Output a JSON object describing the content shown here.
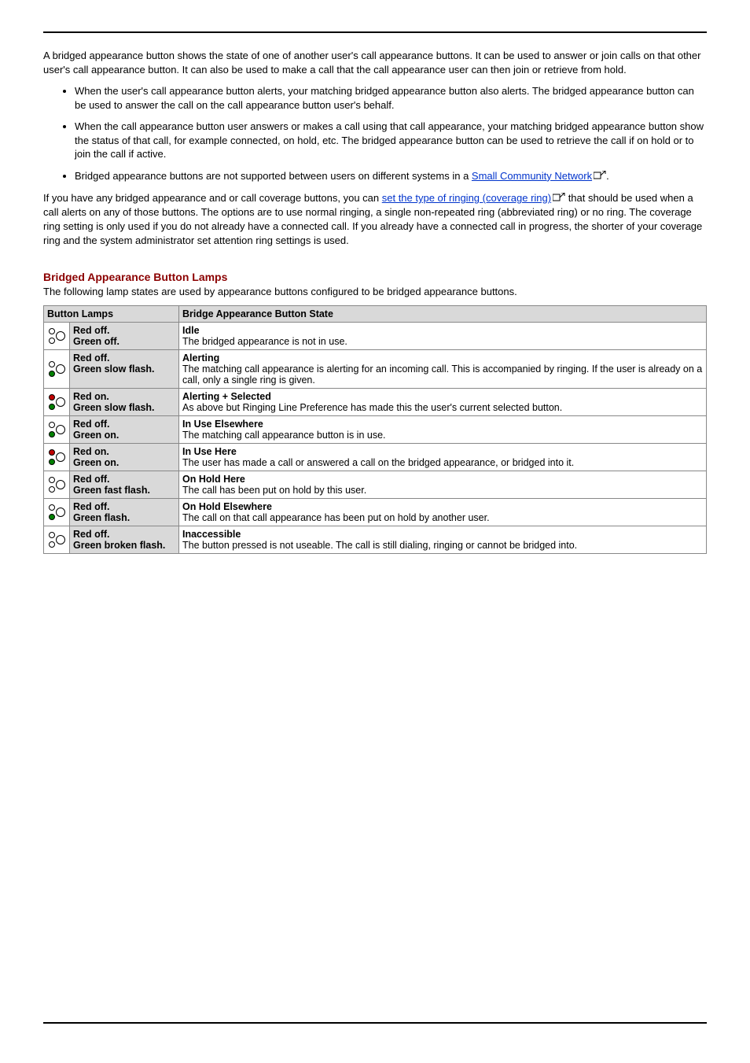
{
  "intro": "A bridged appearance button shows the state of one of another user's call appearance buttons. It can be used to answer or join calls on that other user's call appearance button. It can also be used to make a call that the call appearance user can then join or retrieve from hold.",
  "bullets": [
    "When the user's call appearance button alerts, your matching bridged appearance button also alerts. The bridged appearance button can be used to answer the call on the call appearance button user's behalf.",
    "When the call appearance button user answers or makes a call using that call appearance, your matching bridged appearance button show the status of that call, for example connected, on hold, etc. The bridged appearance button can be used to retrieve the call if on hold or to join the call if active."
  ],
  "bullet3_prefix": "Bridged appearance buttons are not supported between users on different systems in a ",
  "bullet3_link": "Small Community Network",
  "bullet3_suffix": ".",
  "para2_prefix": "If you have any bridged appearance and or call coverage buttons, you can ",
  "para2_link": "set the type of ringing (coverage ring)",
  "para2_suffix": " that should be used when a call alerts on any of those buttons. The options are to use normal ringing, a single non-repeated ring (abbreviated ring) or no ring. The coverage ring setting is only used if you do not already have a connected call. If you already have a connected call in progress, the shorter of your coverage ring and the system administrator set attention ring settings is used.",
  "section_heading": "Bridged Appearance Button Lamps",
  "section_sub": "The following lamp states are used by appearance buttons configured to be bridged appearance buttons.",
  "table": {
    "header": {
      "col1": "Button Lamps",
      "col2": "Bridge Appearance Button State"
    },
    "rows": [
      {
        "lamp": {
          "red": "off",
          "green": "off"
        },
        "label": "Red off.\nGreen off.",
        "state_title": "Idle",
        "state_desc": "The bridged appearance is not in use."
      },
      {
        "lamp": {
          "red": "off",
          "green": "on"
        },
        "label": "Red off.\nGreen slow flash.",
        "state_title": "Alerting",
        "state_desc": "The matching call appearance is alerting for an incoming call. This is accompanied by ringing. If the user is already on a call, only a single ring is given."
      },
      {
        "lamp": {
          "red": "on",
          "green": "on"
        },
        "label": "Red on.\nGreen slow flash.",
        "state_title": "Alerting + Selected",
        "state_desc": "As above but Ringing Line Preference has made this the user's current selected button."
      },
      {
        "lamp": {
          "red": "off",
          "green": "on"
        },
        "label": "Red off.\nGreen on.",
        "state_title": "In Use Elsewhere",
        "state_desc": "The matching call appearance button is in use."
      },
      {
        "lamp": {
          "red": "on",
          "green": "on"
        },
        "label": "Red on.\nGreen on.",
        "state_title": "In Use Here",
        "state_desc": "The user has made a call or answered a call on the bridged appearance, or bridged into it."
      },
      {
        "lamp": {
          "red": "off",
          "green": "off"
        },
        "label": "Red off.\nGreen fast flash.",
        "state_title": "On Hold Here",
        "state_desc": "The call has been put on hold by this user."
      },
      {
        "lamp": {
          "red": "off",
          "green": "on"
        },
        "label": "Red off.\nGreen flash.",
        "state_title": "On Hold Elsewhere",
        "state_desc": "The call on that call appearance has been put on hold by another user."
      },
      {
        "lamp": {
          "red": "off",
          "green": "off"
        },
        "label": "Red off.\nGreen broken flash.",
        "state_title": "Inaccessible",
        "state_desc": "The button pressed is not useable. The call is still dialing, ringing or cannot be bridged into."
      }
    ]
  }
}
